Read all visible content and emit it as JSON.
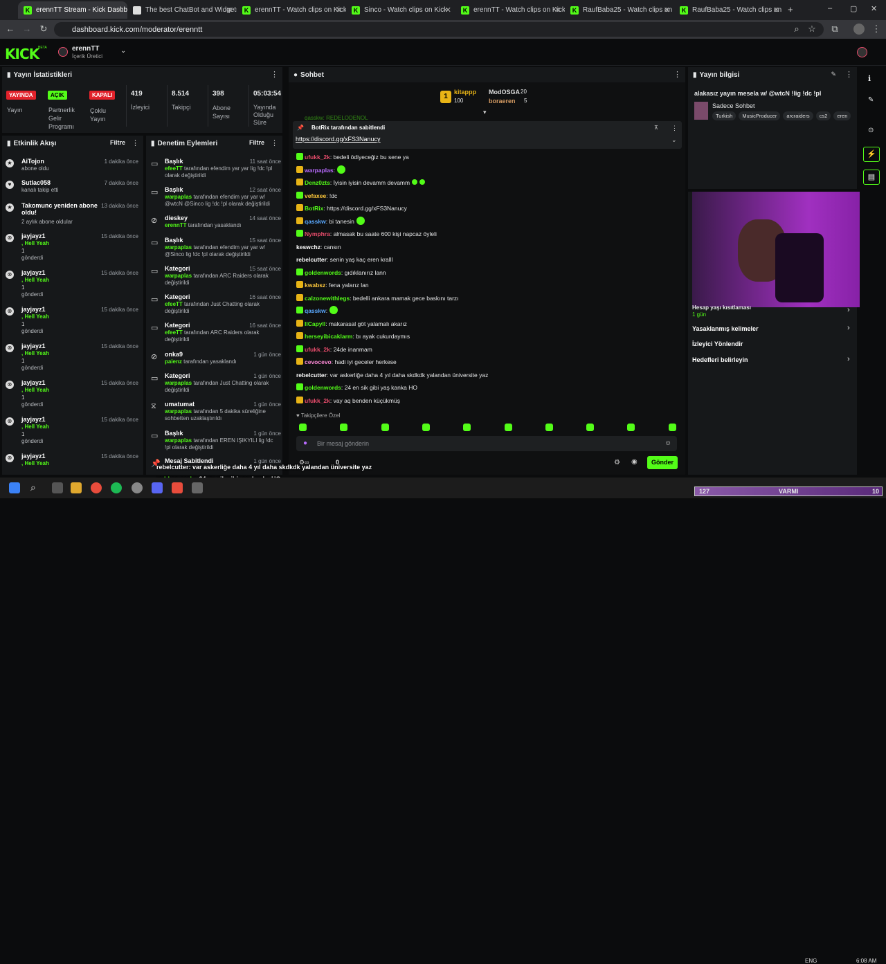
{
  "browser": {
    "tabs": [
      "erennTT Stream - Kick Dashboard",
      "The best ChatBot and Widgets",
      "erennTT - Watch clips on Kick",
      "Sinco - Watch clips on Kick",
      "erennTT - Watch clips on Kick",
      "RaufBaba25 - Watch clips on Kick",
      "RaufBaba25 - Watch clips on Kick"
    ],
    "url": "dashboard.kick.com/moderator/erenntt"
  },
  "header": {
    "logo": "KICK",
    "beta": "BETA",
    "channel": "erennTT",
    "role": "İçerik Üretici"
  },
  "stats": {
    "title": "Yayın İstatistikleri",
    "live_badge": "YAYINDA",
    "live_label": "Yayın",
    "partner_badge": "AÇIK",
    "partner_label": "Partnerlik Gelir Programı",
    "multi_badge": "KAPALI",
    "multi_label": "Çoklu Yayın",
    "viewers": "419",
    "viewers_label": "İzleyici",
    "followers": "8.514",
    "followers_label": "Takipçi",
    "subs": "398",
    "subs_label": "Abone Sayısı",
    "duration": "05:03:54",
    "duration_label": "Yayında Olduğu Süre"
  },
  "activity": {
    "title": "Etkinlik Akışı",
    "filter": "Filtre",
    "items": [
      {
        "name": "AiTojon",
        "sub": "abone oldu",
        "time": "1 dakika önce"
      },
      {
        "name": "Sutlac058",
        "sub": "kanalı takip etti",
        "time": "7 dakika önce"
      },
      {
        "name": "Takomunc yeniden abone oldu!",
        "sub": "2 aylık abone oldular",
        "time": "13 dakika önce"
      },
      {
        "name": "jayjayz1",
        "sub": ", Hell Yeah",
        "count": "1",
        "sent": "gönderdi",
        "time": "15 dakika önce"
      },
      {
        "name": "jayjayz1",
        "sub": ", Hell Yeah",
        "count": "1",
        "sent": "gönderdi",
        "time": "15 dakika önce"
      },
      {
        "name": "jayjayz1",
        "sub": ", Hell Yeah",
        "count": "1",
        "sent": "gönderdi",
        "time": "15 dakika önce"
      },
      {
        "name": "jayjayz1",
        "sub": ", Hell Yeah",
        "count": "1",
        "sent": "gönderdi",
        "time": "15 dakika önce"
      },
      {
        "name": "jayjayz1",
        "sub": ", Hell Yeah",
        "count": "1",
        "sent": "gönderdi",
        "time": "15 dakika önce"
      },
      {
        "name": "jayjayz1",
        "sub": ", Hell Yeah",
        "count": "1",
        "sent": "gönderdi",
        "time": "15 dakika önce"
      },
      {
        "name": "jayjayz1",
        "sub": ", Hell Yeah",
        "time": "15 dakika önce"
      }
    ]
  },
  "moderation": {
    "title": "Denetim Eylemleri",
    "filter": "Filtre",
    "items": [
      {
        "title": "Başlık",
        "by": "efeeTT",
        "desc": "tarafından efendim yar yar lig !dc !pl olarak değiştirildi",
        "time": "11 saat önce"
      },
      {
        "title": "Başlık",
        "by": "warpaplas",
        "desc": "tarafından efendim yar yar w/ @wtcN @Sinco lig !dc !pl olarak değiştirildi",
        "time": "12 saat önce"
      },
      {
        "title": "dieskey",
        "by": "erennTT",
        "desc": "tarafından yasaklandı",
        "time": "14 saat önce"
      },
      {
        "title": "Başlık",
        "by": "warpaplas",
        "desc": "tarafından efendim yar yar w/ @Sinco lig !dc !pl olarak değiştirildi",
        "time": "15 saat önce"
      },
      {
        "title": "Kategori",
        "by": "warpaplas",
        "desc": "tarafından ARC Raiders olarak değiştirildi",
        "time": "15 saat önce"
      },
      {
        "title": "Kategori",
        "by": "efeeTT",
        "desc": "tarafından Just Chatting olarak değiştirildi",
        "time": "16 saat önce"
      },
      {
        "title": "Kategori",
        "by": "efeeTT",
        "desc": "tarafından ARC Raiders olarak değiştirildi",
        "time": "16 saat önce"
      },
      {
        "title": "onka9",
        "by": "paienz",
        "desc": "tarafından yasaklandı",
        "time": "1 gün önce"
      },
      {
        "title": "Kategori",
        "by": "warpaplas",
        "desc": "tarafından Just Chatting olarak değiştirildi",
        "time": "1 gün önce"
      },
      {
        "title": "umatumat",
        "by": "warpaplas",
        "desc": "tarafından 5 dakika süreliğine sohbetten uzaklaştırıldı",
        "time": "1 gün önce"
      },
      {
        "title": "Başlık",
        "by": "warpaplas",
        "desc": "tarafından EREN IŞIKYILI lig !dc !pl olarak değiştirildi",
        "time": "1 gün önce"
      },
      {
        "title": "Mesaj Sabitlendi",
        "time": "1 gün önce"
      }
    ]
  },
  "chat": {
    "title": "Sohbet",
    "leader1": "kitappp",
    "leader1_count": "100",
    "leader2": "ModOSGA",
    "leader2_count": "20",
    "leader3": "boraeren",
    "leader3_count": "5",
    "pinned_by": "BotRix tarafından sabitlendi",
    "pinned_link": "https://discord.gg/xFS3Nanucy",
    "partial_top": "qasskw: REDELODENOL",
    "messages": [
      {
        "user": "ufukk_2k",
        "color": "#e84c6b",
        "text": ": bedeli ödiyeceğiz bu sene ya"
      },
      {
        "user": "warpaplas",
        "color": "#b96bff",
        "text": ":"
      },
      {
        "user": "Denz0zts",
        "color": "#53fc18",
        "text": ": İyisin iyisin devamm devamm"
      },
      {
        "user": "vefaxee",
        "color": "#ffc93c",
        "text": ": !dc"
      },
      {
        "user": "BotRix",
        "color": "#53fc18",
        "text": ": https://discord.gg/xFS3Nanucy"
      },
      {
        "user": "qasskw",
        "color": "#5aa9ff",
        "text": ": bi tanesin"
      },
      {
        "user": "Nymphra",
        "color": "#e84c6b",
        "text": ": almasak bu saate 600 kişi napcaz öyleli"
      },
      {
        "user": "keswchz",
        "color": "#ffffff",
        "text": ": cansın"
      },
      {
        "user": "rebelcutter",
        "color": "#ffffff",
        "text": ": senin yaş kaç eren kralll"
      },
      {
        "user": "goldenwords",
        "color": "#53fc18",
        "text": ": gıdıklanırız lann"
      },
      {
        "user": "kwabsz",
        "color": "#ffc93c",
        "text": ": fena yalarız lan"
      },
      {
        "user": "calzonewithlegs",
        "color": "#53fc18",
        "text": ": bedelli ankara mamak gece baskını tarzı"
      },
      {
        "user": "qasskw",
        "color": "#5aa9ff",
        "text": ":"
      },
      {
        "user": "IlCapyll",
        "color": "#53fc18",
        "text": ": makarasal göt yalamalı akarız"
      },
      {
        "user": "herseyibicaklarm",
        "color": "#53fc18",
        "text": ": bı ayak cukurdaymıs"
      },
      {
        "user": "ufukk_2k",
        "color": "#e84c6b",
        "text": ": 24de inanmam"
      },
      {
        "user": "cevocevo",
        "color": "#ff8ad8",
        "text": ": hadi iyi geceler herkese"
      },
      {
        "user": "rebelcutter",
        "color": "#ffffff",
        "text": ": var askerliğe daha 4 yıl daha skdkdk yalandan üniversite yaz"
      },
      {
        "user": "goldenwords",
        "color": "#53fc18",
        "text": ": 24 en sik gibi yaş kanka HO"
      },
      {
        "user": "ufukk_2k",
        "color": "#e84c6b",
        "text": ": vay aq benden küçükmüş"
      }
    ],
    "followers_only": "Takipçilere Özel",
    "placeholder": "Bir mesaj gönderin",
    "points": "0",
    "send": "Gönder"
  },
  "info": {
    "title": "Yayın bilgisi",
    "stream_title": "alakasız yayın mesela w/ @wtcN !lig !dc !pl",
    "category": "Sadece Sohbet",
    "tags": [
      "Turkish",
      "MusicProducer",
      "arcraiders",
      "cs2",
      "eren"
    ],
    "menu": [
      "Hesap yaşı kısıtlaması",
      "1 gün",
      "Yasaklanmış kelimeler",
      "İzleyici Yönlendir",
      "Hedefleri belirleyin"
    ]
  },
  "overlay": {
    "lines": [
      {
        "user": "rebelcutter",
        "text": ": var askerliğe daha 4 yıl daha skdkdk yalandan üniversite yaz"
      },
      {
        "user": "goldenwords",
        "text": ": 24 en sik gibi yaş kanka HO"
      },
      {
        "user": "ufukk_2k",
        "text": ": vay aq benden küçükmüş"
      }
    ]
  },
  "goal": {
    "left": "127",
    "label": "VARMI",
    "right": "10"
  },
  "tray": {
    "lang": "ENG",
    "time": "6:08 AM"
  }
}
